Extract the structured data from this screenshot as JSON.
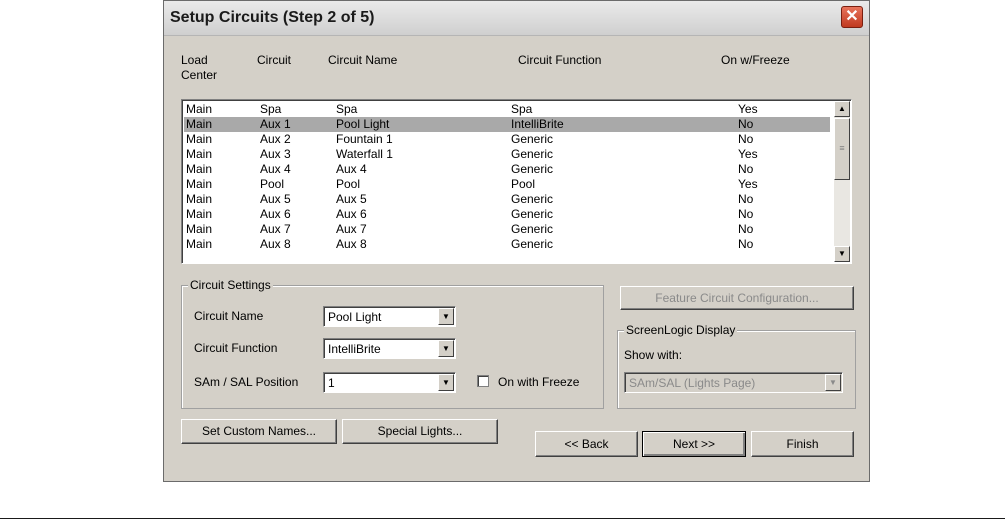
{
  "window": {
    "title": "Setup Circuits (Step 2 of 5)",
    "close_glyph": "✕"
  },
  "columns": [
    "Load\nCenter",
    "Circuit",
    "Circuit Name",
    "Circuit Function",
    "On w/Freeze"
  ],
  "rows": [
    [
      "Main",
      "Spa",
      "Spa",
      "Spa",
      "Yes"
    ],
    [
      "Main",
      "Aux 1",
      "Pool Light",
      "IntelliBrite",
      "No"
    ],
    [
      "Main",
      "Aux 2",
      "Fountain 1",
      "Generic",
      "No"
    ],
    [
      "Main",
      "Aux 3",
      "Waterfall 1",
      "Generic",
      "Yes"
    ],
    [
      "Main",
      "Aux 4",
      "Aux 4",
      "Generic",
      "No"
    ],
    [
      "Main",
      "Pool",
      "Pool",
      "Pool",
      "Yes"
    ],
    [
      "Main",
      "Aux 5",
      "Aux 5",
      "Generic",
      "No"
    ],
    [
      "Main",
      "Aux 6",
      "Aux 6",
      "Generic",
      "No"
    ],
    [
      "Main",
      "Aux 7",
      "Aux 7",
      "Generic",
      "No"
    ],
    [
      "Main",
      "Aux 8",
      "Aux 8",
      "Generic",
      "No"
    ]
  ],
  "selected_row": 1,
  "circuit_settings": {
    "title": "Circuit Settings",
    "name_label": "Circuit Name",
    "name_value": "Pool Light",
    "function_label": "Circuit Function",
    "function_value": "IntelliBrite",
    "position_label": "SAm / SAL Position",
    "position_value": "1",
    "freeze_label": "On with Freeze",
    "freeze_checked": false
  },
  "feature_button": "Feature Circuit Configuration...",
  "screenlogic": {
    "title": "ScreenLogic Display",
    "show_label": "Show with:",
    "show_value": "SAm/SAL (Lights Page)"
  },
  "buttons": {
    "custom_names": "Set Custom Names...",
    "special_lights": "Special Lights...",
    "back": "<< Back",
    "next": "Next >>",
    "finish": "Finish"
  },
  "icons": {
    "scroll_up": "▲",
    "scroll_down": "▼",
    "dropdown": "▼",
    "grip": "≡"
  }
}
